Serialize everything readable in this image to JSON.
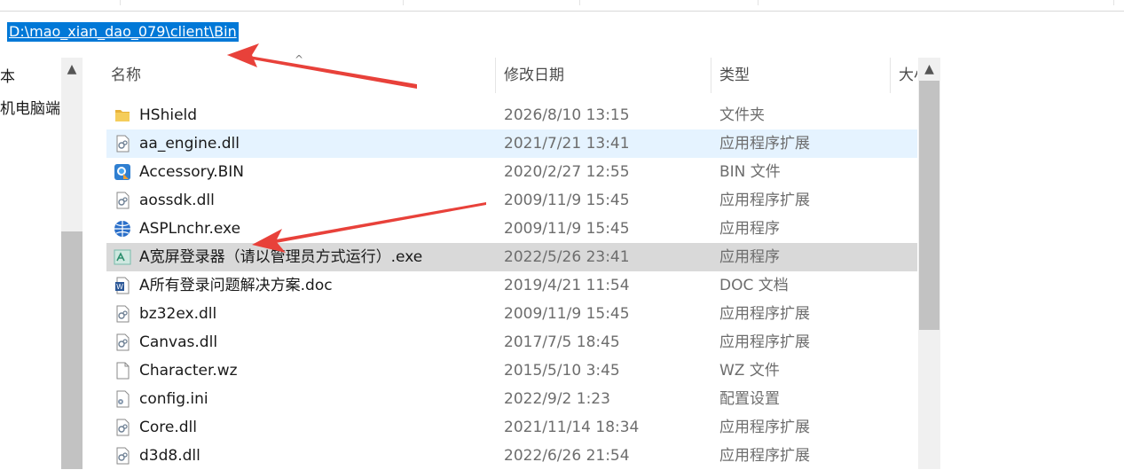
{
  "address": {
    "path": "D:\\mao_xian_dao_079\\client\\Bin"
  },
  "nav": {
    "item1": "本",
    "item2": "机电脑端"
  },
  "columns": {
    "name": "名称",
    "date": "修改日期",
    "type": "类型",
    "size": "大小"
  },
  "files": [
    {
      "name": "HShield",
      "date": "2026/8/10 13:15",
      "type": "文件夹",
      "icon": "folder-icon"
    },
    {
      "name": "aa_engine.dll",
      "date": "2021/7/21 13:41",
      "type": "应用程序扩展",
      "icon": "dll-file-icon"
    },
    {
      "name": "Accessory.BIN",
      "date": "2020/2/27 12:55",
      "type": "BIN 文件",
      "icon": "bin-file-icon"
    },
    {
      "name": "aossdk.dll",
      "date": "2009/11/9 15:45",
      "type": "应用程序扩展",
      "icon": "dll-file-icon"
    },
    {
      "name": "ASPLnchr.exe",
      "date": "2009/11/9 15:45",
      "type": "应用程序",
      "icon": "globe-exe-icon"
    },
    {
      "name": "A宽屏登录器（请以管理员方式运行）.exe",
      "date": "2022/5/26 23:41",
      "type": "应用程序",
      "icon": "launcher-exe-icon"
    },
    {
      "name": "A所有登录问题解决方案.doc",
      "date": "2019/4/21 11:54",
      "type": "DOC 文档",
      "icon": "word-doc-icon"
    },
    {
      "name": "bz32ex.dll",
      "date": "2009/11/9 15:45",
      "type": "应用程序扩展",
      "icon": "dll-file-icon"
    },
    {
      "name": "Canvas.dll",
      "date": "2017/7/5 18:45",
      "type": "应用程序扩展",
      "icon": "dll-file-icon"
    },
    {
      "name": "Character.wz",
      "date": "2015/5/10 3:45",
      "type": "WZ 文件",
      "icon": "blank-file-icon"
    },
    {
      "name": "config.ini",
      "date": "2022/9/2 1:23",
      "type": "配置设置",
      "icon": "ini-file-icon"
    },
    {
      "name": "Core.dll",
      "date": "2021/11/14 18:34",
      "type": "应用程序扩展",
      "icon": "dll-file-icon"
    },
    {
      "name": "d3d8.dll",
      "date": "2022/6/26 21:54",
      "type": "应用程序扩展",
      "icon": "dll-file-icon"
    }
  ],
  "colors": {
    "accent": "#0078d7",
    "hover": "#e5f3ff",
    "selected": "#d9d9d9",
    "arrow": "#e8413a"
  }
}
